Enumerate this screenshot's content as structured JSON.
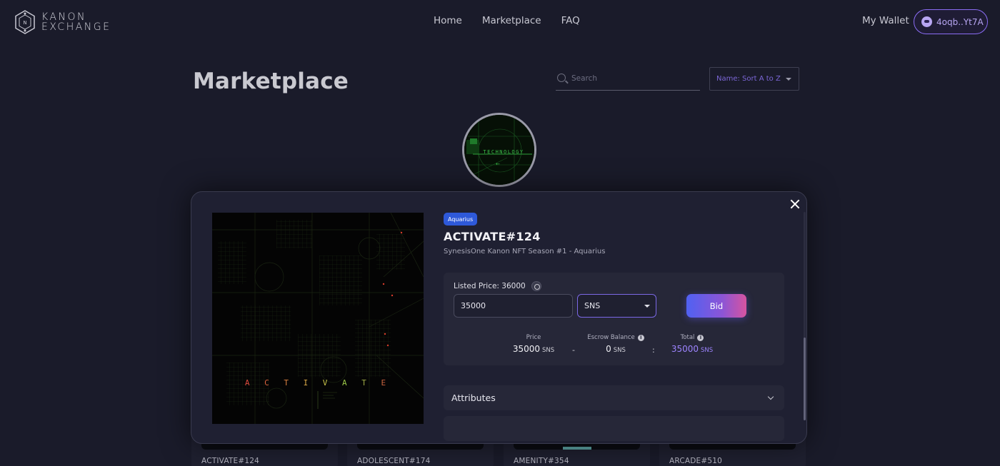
{
  "header": {
    "logo_line1": "KANON",
    "logo_line2": "EXCHANGE",
    "nav": [
      "Home",
      "Marketplace",
      "FAQ"
    ],
    "my_wallet": "My Wallet",
    "wallet_address": "4oqb..Yt7A"
  },
  "page": {
    "title": "Marketplace",
    "search_placeholder": "Search",
    "sort_label": "Name: Sort A to Z",
    "collection_avatar_text": "TECHNOLOGY"
  },
  "modal": {
    "tag": "Aquarius",
    "title": "ACTIVATE#124",
    "subtitle": "SynesisOne Kanon NFT Season #1 - Aquarius",
    "art_word": "A C T I V A T E",
    "listed_price_label": "Listed Price: 36000",
    "amount_value": "35000",
    "currency": "SNS",
    "bid_label": "Bid",
    "stats": {
      "price_label": "Price",
      "price_value": "35000",
      "escrow_label": "Escrow Balance",
      "escrow_value": "0",
      "total_label": "Total",
      "total_value": "35000",
      "unit": "SNS",
      "minus": "-",
      "colon": ":"
    },
    "attributes_label": "Attributes"
  },
  "cards": [
    "ACTIVATE#124",
    "ADOLESCENT#174",
    "AMENITY#354",
    "ARCADE#510"
  ],
  "colors": {
    "background": "#1a1b2a",
    "accent": "#8b6df5",
    "tag": "#2e59d9",
    "total": "#9d84ff"
  },
  "icons": [
    "search-icon",
    "close-icon",
    "chevron-down-icon",
    "info-icon",
    "coin-icon"
  ]
}
